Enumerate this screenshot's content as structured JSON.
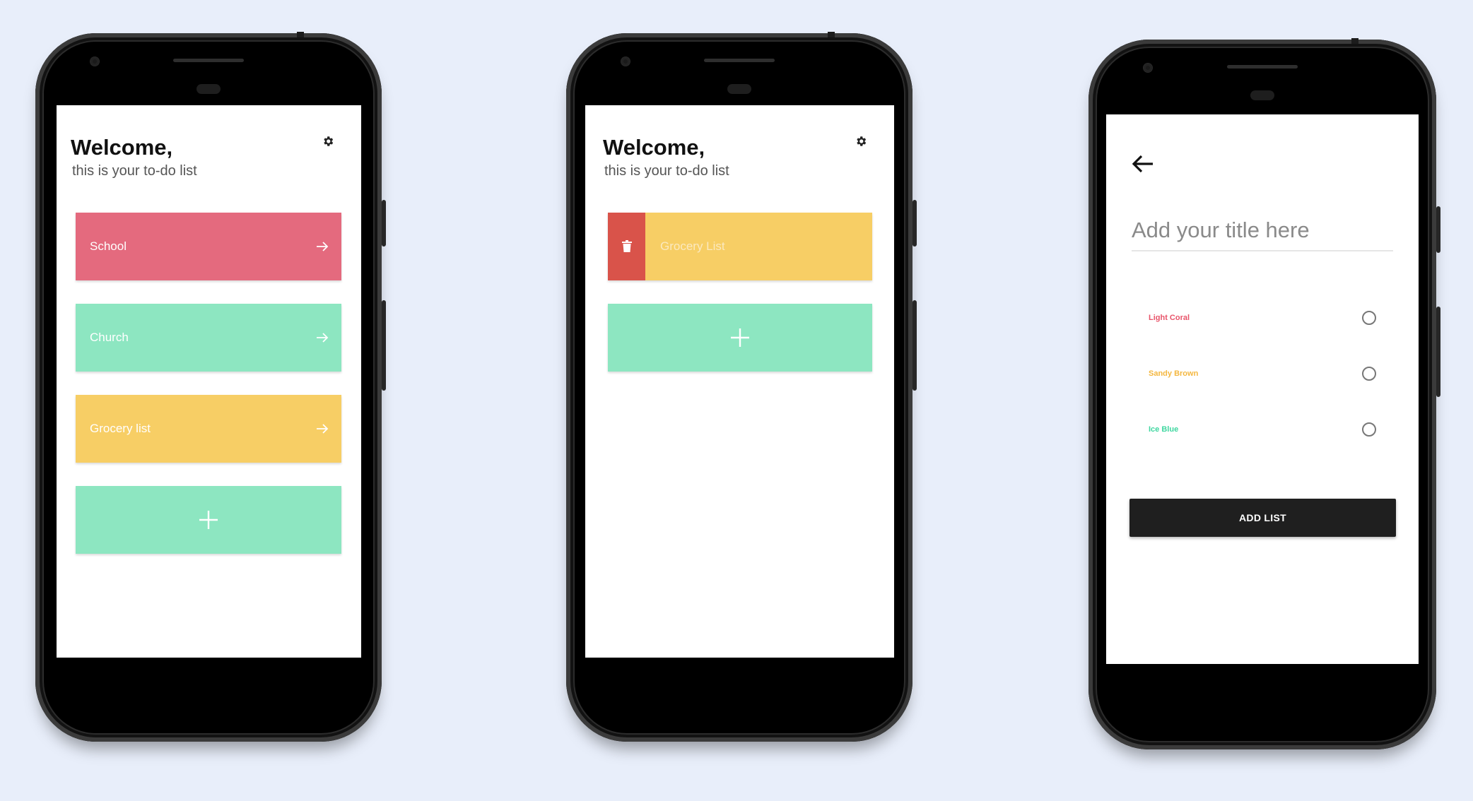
{
  "colors": {
    "background": "#e8eefa",
    "coral": "#e46a7e",
    "mint": "#8de6c1",
    "yellow": "#f7ce65",
    "delete_red": "#d9534a",
    "dark_button": "#1f1f1f"
  },
  "phone1": {
    "welcome_title": "Welcome,",
    "welcome_subtitle": "this is your to-do list",
    "settings_icon": "gear-icon",
    "lists": [
      {
        "label": "School",
        "color": "#e46a7e",
        "icon": "arrow-right-icon"
      },
      {
        "label": "Church",
        "color": "#8de6c1",
        "icon": "arrow-right-icon"
      },
      {
        "label": "Grocery list",
        "color": "#f7ce65",
        "icon": "arrow-right-icon"
      }
    ],
    "add_icon": "plus-icon"
  },
  "phone2": {
    "welcome_title": "Welcome,",
    "welcome_subtitle": "this is your to-do list",
    "settings_icon": "gear-icon",
    "swiped_item": {
      "label": "Grocery List",
      "color": "#f7ce65",
      "delete_icon": "trash-icon"
    },
    "add_icon": "plus-icon"
  },
  "phone3": {
    "back_icon": "arrow-left-icon",
    "title_placeholder": "Add your title here",
    "color_options": [
      {
        "label": "Light Coral",
        "color": "#e8546a"
      },
      {
        "label": "Sandy Brown",
        "color": "#f4b740"
      },
      {
        "label": "Ice Blue",
        "color": "#3fd7a0"
      }
    ],
    "add_button_label": "ADD LIST"
  }
}
